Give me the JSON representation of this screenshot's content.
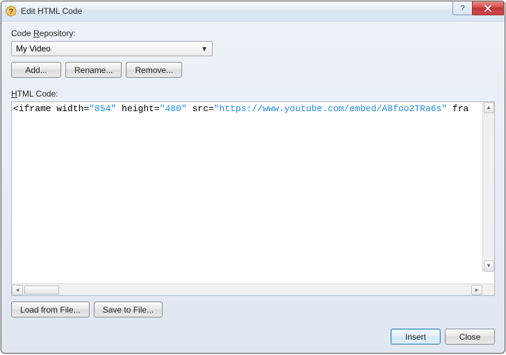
{
  "window": {
    "title": "Edit HTML Code"
  },
  "repo": {
    "label_pre": "Code ",
    "label_u": "R",
    "label_post": "epository:",
    "selected": "My Video",
    "add": "Add...",
    "rename": "Rename...",
    "remove": "Remove..."
  },
  "html": {
    "label_u": "H",
    "label_post": "TML Code:",
    "code_prefix": "<iframe width=",
    "code_width": "\"854\"",
    "code_mid1": " height=",
    "code_height": "\"480\"",
    "code_mid2": " src=",
    "code_src": "\"https://www.youtube.com/embed/A8foo2TRa6s\"",
    "code_suffix": " fra"
  },
  "file": {
    "load": "Load from File...",
    "save": "Save to File..."
  },
  "footer": {
    "insert": "Insert",
    "close": "Close"
  },
  "titlebar": {
    "help": "?"
  }
}
